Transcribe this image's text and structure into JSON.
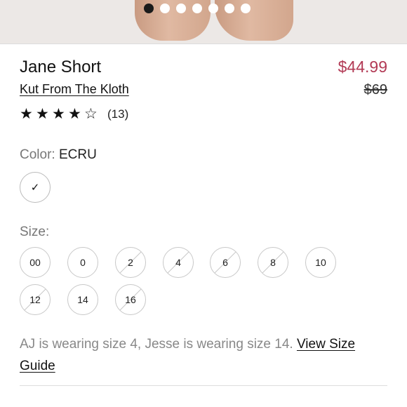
{
  "carousel": {
    "total": 7,
    "active": 0
  },
  "product": {
    "title": "Jane Short",
    "brand": "Kut From The Kloth",
    "sale_price": "$44.99",
    "original_price": "$69",
    "rating": 4,
    "rating_max": 5,
    "review_count": "(13)"
  },
  "color": {
    "label": "Color:",
    "selected": "ECRU",
    "swatch_check": "✓"
  },
  "size": {
    "label": "Size:",
    "options": [
      {
        "label": "00",
        "available": true
      },
      {
        "label": "0",
        "available": true
      },
      {
        "label": "2",
        "available": false
      },
      {
        "label": "4",
        "available": false
      },
      {
        "label": "6",
        "available": false
      },
      {
        "label": "8",
        "available": false
      },
      {
        "label": "10",
        "available": true
      },
      {
        "label": "12",
        "available": false
      },
      {
        "label": "14",
        "available": true
      },
      {
        "label": "16",
        "available": false
      }
    ]
  },
  "model_note": {
    "text": "AJ is wearing size 4, Jesse is wearing size 14.",
    "link": "View Size Guide"
  },
  "colors": {
    "sale_price": "#b23a55",
    "active_dot": "#1a1a1a"
  }
}
